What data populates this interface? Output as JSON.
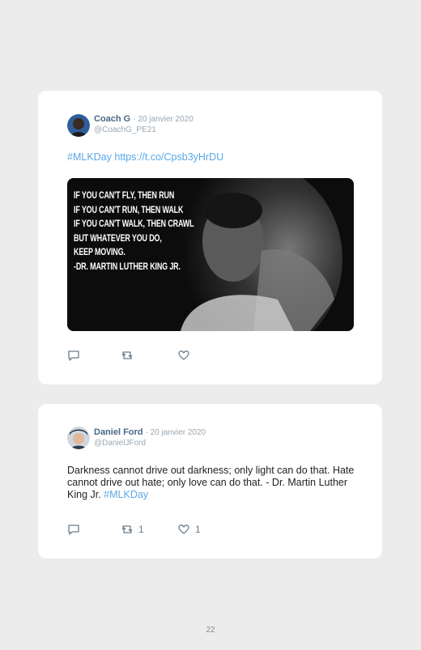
{
  "tweets": [
    {
      "name": "Coach G",
      "date": "· 20 janvier 2020",
      "handle": "@CoachG_PE21",
      "text_parts": {
        "hashtag": "#MLKDay",
        "link": "https://t.co/Cpsb3yHrDU"
      },
      "image_quote": [
        "IF YOU CAN'T FLY, THEN RUN",
        "IF YOU CAN'T RUN, THEN WALK",
        "IF YOU CAN'T WALK, THEN CRAWL",
        "BUT WHATEVER YOU DO,",
        "KEEP MOVING.",
        "-DR. MARTIN LUTHER KING JR."
      ],
      "counts": {
        "reply": "",
        "retweet": "",
        "like": ""
      }
    },
    {
      "name": "Daniel Ford",
      "date": "· 20 janvier 2020",
      "handle": "@DanielJFord",
      "text": "Darkness cannot drive out darkness; only light can do that. Hate cannot drive out hate; only love can do that. - Dr. Martin Luther King Jr.",
      "hashtag": "#MLKDay",
      "counts": {
        "reply": "",
        "retweet": "1",
        "like": "1"
      }
    }
  ],
  "page_number": "22",
  "icons": [
    "reply-icon",
    "retweet-icon",
    "like-icon"
  ]
}
